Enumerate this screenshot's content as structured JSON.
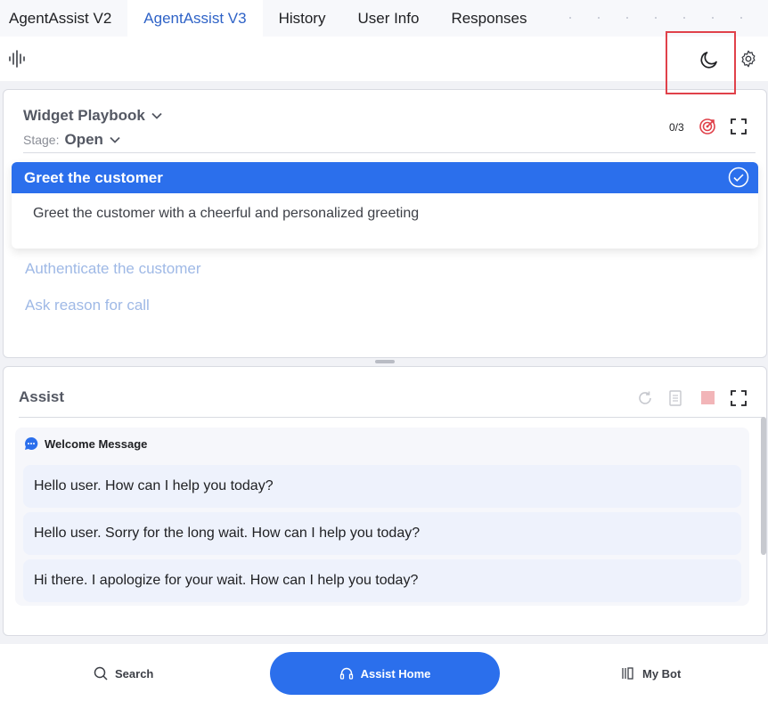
{
  "tabs": [
    {
      "label": "AgentAssist V2",
      "active": false
    },
    {
      "label": "AgentAssist V3",
      "active": true
    },
    {
      "label": "History",
      "active": false
    },
    {
      "label": "User Info",
      "active": false
    },
    {
      "label": "Responses",
      "active": false
    }
  ],
  "toolbar": {
    "icons": [
      "voice-wave-icon",
      "moon-icon",
      "gear-icon"
    ]
  },
  "playbook": {
    "title": "Widget Playbook",
    "stage_label": "Stage:",
    "stage_value": "Open",
    "progress": "0/3",
    "steps": [
      {
        "title": "Greet the customer",
        "description": "Greet the customer with a cheerful and personalized greeting",
        "expanded": true,
        "completed": true
      },
      {
        "title": "Authenticate the customer",
        "expanded": false
      },
      {
        "title": "Ask reason for call",
        "expanded": false
      }
    ]
  },
  "assist": {
    "title": "Assist",
    "welcome_title": "Welcome Message",
    "messages": [
      "Hello user. How can I help you today?",
      "Hello user. Sorry for the long wait. How can I help you today?",
      "Hi there. I apologize for your wait. How can I help you today?"
    ]
  },
  "bottom_nav": {
    "search": "Search",
    "assist_home": "Assist Home",
    "my_bot": "My Bot"
  },
  "colors": {
    "accent": "#2b6fec",
    "active_tab_text": "#2f63c7",
    "highlight_box": "#e0414a"
  }
}
